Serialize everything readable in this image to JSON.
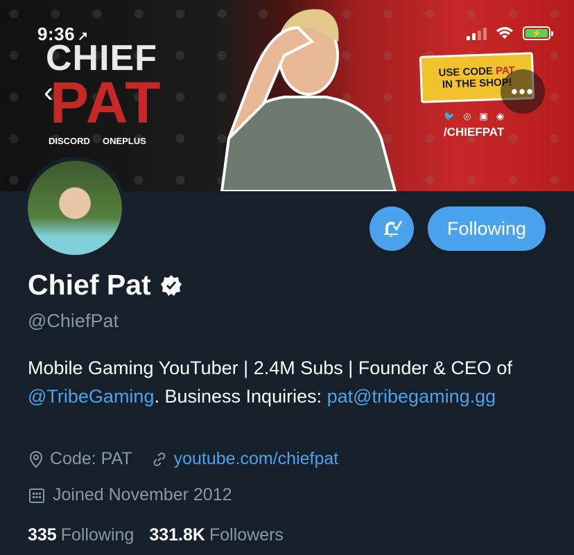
{
  "status_bar": {
    "time": "9:36",
    "location_glyph": "↗"
  },
  "banner": {
    "logo_top": "CHIEF",
    "logo_bottom": "PAT",
    "sponsors": [
      "DISCORD",
      "ONEPLUS"
    ],
    "promo_line1_a": "USE CODE ",
    "promo_line1_b": "PAT",
    "promo_line2": "IN THE SHOP!",
    "social_handle": "/CHIEFPAT",
    "colors": {
      "accent_red": "#c62828",
      "promo_yellow": "#f2c12e"
    }
  },
  "nav": {
    "back_glyph": "‹",
    "more_glyph": "•••"
  },
  "actions": {
    "following_label": "Following"
  },
  "profile": {
    "name": "Chief Pat",
    "handle": "@ChiefPat",
    "bio_1": "Mobile Gaming YouTuber | 2.4M Subs | Founder & CEO of ",
    "bio_mention": "@TribeGaming",
    "bio_2": ". Business Inquiries: ",
    "bio_email": "pat@tribegaming.gg",
    "location": "Code: PAT",
    "website": "youtube.com/chiefpat",
    "joined": "Joined November 2012",
    "following_count": "335",
    "following_label": "Following",
    "followers_count": "331.8K",
    "followers_label": "Followers"
  },
  "theme": {
    "background": "#15202b",
    "accent": "#4aa3ec",
    "secondary_text": "#8899a6"
  }
}
